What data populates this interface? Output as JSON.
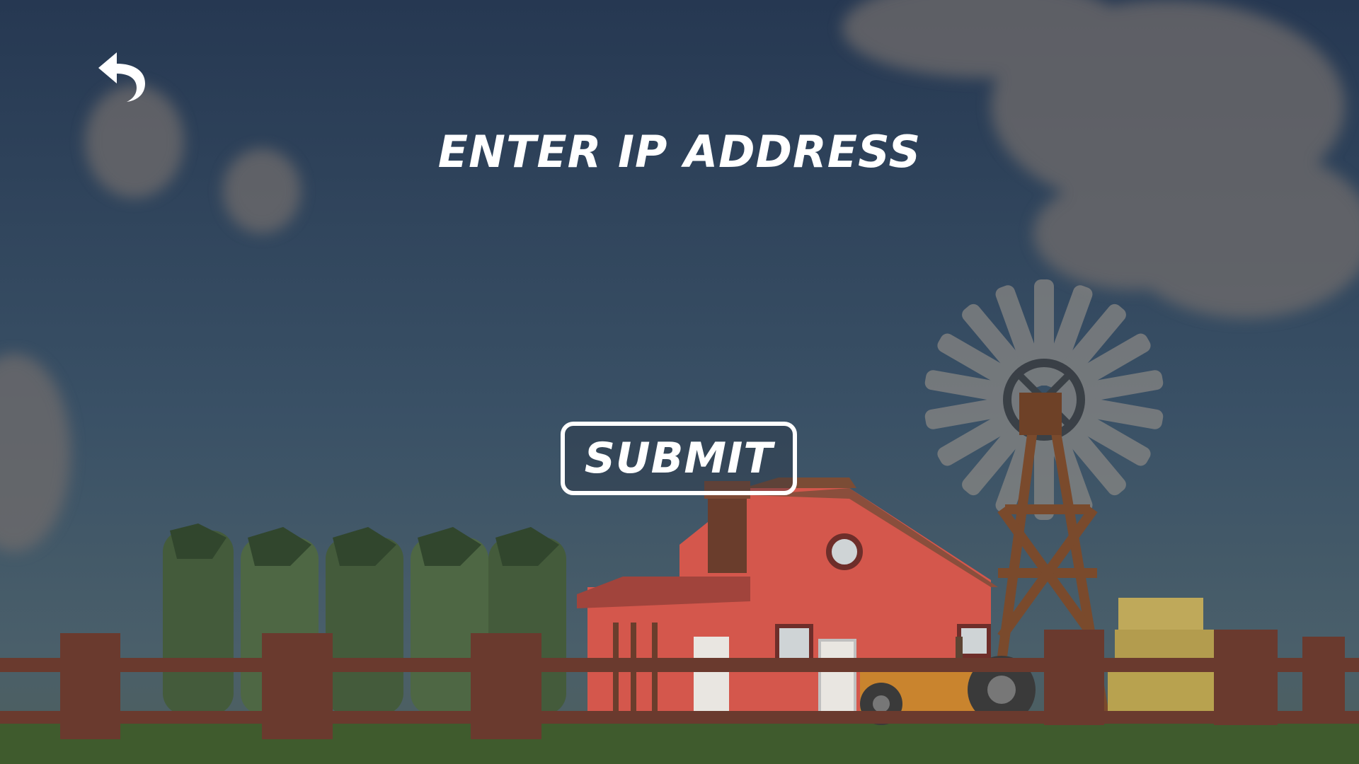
{
  "screen": {
    "title": "ENTER IP ADDRESS",
    "ip_value": "",
    "submit_label": "SUBMIT"
  },
  "icons": {
    "back": "back-arrow-icon"
  },
  "colors": {
    "text": "#ffffff",
    "barn": "#d4574c",
    "grass": "#3f5b2d"
  }
}
